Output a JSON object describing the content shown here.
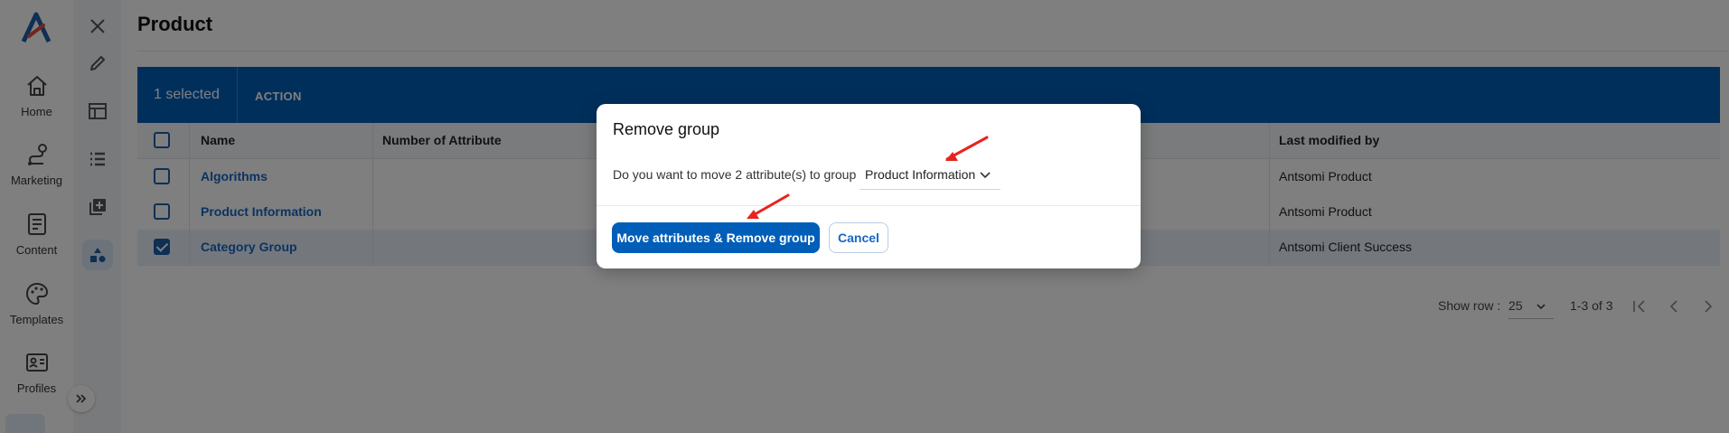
{
  "nav": {
    "items": [
      {
        "label": "Home",
        "icon": "home-icon"
      },
      {
        "label": "Marketing",
        "icon": "marketing-route-icon"
      },
      {
        "label": "Content",
        "icon": "content-document-icon"
      },
      {
        "label": "Templates",
        "icon": "palette-icon"
      },
      {
        "label": "Profiles",
        "icon": "profile-card-icon"
      }
    ],
    "brand_color": "#1f5fa8",
    "logo_accent": "#e4483e"
  },
  "toolbar": {
    "icons": [
      "close-icon",
      "edit-pencil-icon",
      "table-layout-icon",
      "list-icon",
      "add-library-icon",
      "shapes-icon"
    ],
    "active": "shapes-icon"
  },
  "page": {
    "title": "Product"
  },
  "bulk": {
    "selected_text": "1 selected",
    "action_label": "ACTION",
    "bar_color": "#005eb8"
  },
  "table": {
    "columns": [
      "Name",
      "Number of Attribute",
      "Last modified by"
    ],
    "rows": [
      {
        "name": "Algorithms",
        "modified_by": "Antsomi Product",
        "checked": false
      },
      {
        "name": "Product Information",
        "modified_by": "Antsomi Product",
        "checked": false
      },
      {
        "name": "Category Group",
        "modified_by": "Antsomi Client Success",
        "checked": true
      }
    ]
  },
  "pager": {
    "show_row_label": "Show row :",
    "rows_per_page": "25",
    "range": "1-3 of 3"
  },
  "dialog": {
    "title": "Remove group",
    "message": "Do you want to move 2 attribute(s) to group",
    "selected_group": "Product Information",
    "primary_button": "Move attributes & Remove group",
    "secondary_button": "Cancel",
    "annotation_color": "#e8231f"
  }
}
